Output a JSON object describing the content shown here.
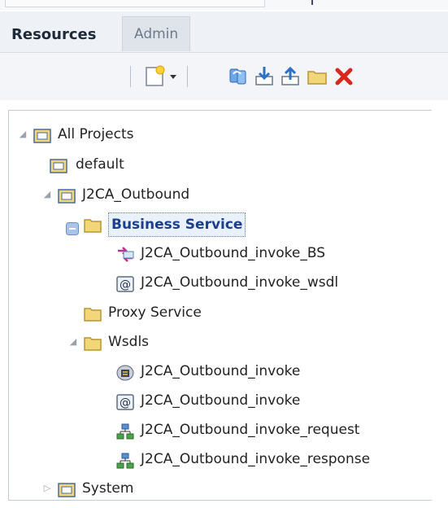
{
  "tabs": {
    "resources": "Resources",
    "admin": "Admin"
  },
  "toolbar": {
    "buttons": [
      "create-resource-icon",
      "dropdown-icon",
      "refresh-icon",
      "import-icon",
      "export-icon",
      "folder-icon",
      "delete-icon"
    ]
  },
  "tree": {
    "all_projects": "All Projects",
    "default": "default",
    "j2ca_outbound": "J2CA_Outbound",
    "business_service": "Business Service",
    "bs_invoke": "J2CA_Outbound_invoke_BS",
    "bs_wsdl": "J2CA_Outbound_invoke_wsdl",
    "proxy_service": "Proxy Service",
    "wsdls": "Wsdls",
    "wsdl_invoke_1": "J2CA_Outbound_invoke",
    "wsdl_invoke_2": "J2CA_Outbound_invoke",
    "wsdl_request": "J2CA_Outbound_invoke_request",
    "wsdl_response": "J2CA_Outbound_invoke_response",
    "system": "System"
  },
  "colors": {
    "selected_text": "#1b3f8f",
    "folder": "#f2d67a",
    "delete": "#d8281c"
  }
}
